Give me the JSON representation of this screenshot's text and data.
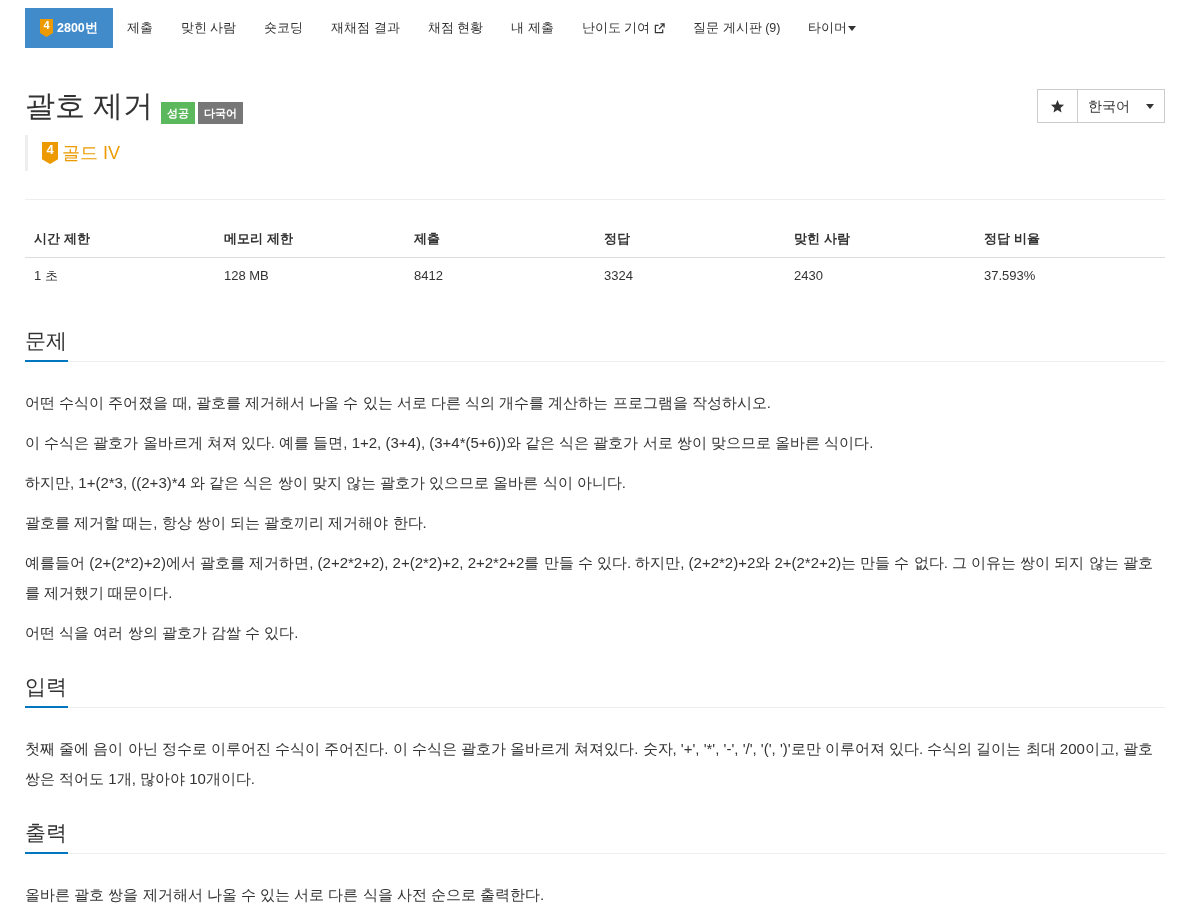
{
  "nav": {
    "tabs": [
      {
        "label": "2800번",
        "kind": "tier",
        "badge": "4",
        "selected": true
      },
      {
        "label": "제출",
        "kind": "plain",
        "selected": false
      },
      {
        "label": "맞힌 사람",
        "kind": "plain",
        "selected": false
      },
      {
        "label": "숏코딩",
        "kind": "plain",
        "selected": false
      },
      {
        "label": "재채점 결과",
        "kind": "plain",
        "selected": false
      },
      {
        "label": "채점 현황",
        "kind": "plain",
        "selected": false
      },
      {
        "label": "내 제출",
        "kind": "plain",
        "selected": false
      },
      {
        "label": "난이도 기여",
        "kind": "external",
        "selected": false
      },
      {
        "label": "질문 게시판 (9)",
        "kind": "plain",
        "selected": false
      },
      {
        "label": "타이머",
        "kind": "dropdown",
        "selected": false
      }
    ]
  },
  "problem": {
    "title": "괄호 제거",
    "labels": [
      {
        "text": "성공",
        "color": "#5cb85c"
      },
      {
        "text": "다국어",
        "color": "#777777"
      }
    ],
    "tier": {
      "badge": "4",
      "name": "골드 IV"
    }
  },
  "toolbar": {
    "language": "한국어"
  },
  "stats": {
    "columns": [
      "시간 제한",
      "메모리 제한",
      "제출",
      "정답",
      "맞힌 사람",
      "정답 비율"
    ],
    "rows": [
      [
        "1 초",
        "128 MB",
        "8412",
        "3324",
        "2430",
        "37.593%"
      ]
    ]
  },
  "sections": [
    {
      "title": "문제",
      "paragraphs": [
        "어떤 수식이 주어졌을 때, 괄호를 제거해서 나올 수 있는 서로 다른 식의 개수를 계산하는 프로그램을 작성하시오.",
        "이 수식은 괄호가 올바르게 쳐져 있다. 예를 들면, 1+2, (3+4), (3+4*(5+6))와 같은 식은 괄호가 서로 쌍이 맞으므로 올바른 식이다.",
        "하지만, 1+(2*3, ((2+3)*4 와 같은 식은 쌍이 맞지 않는 괄호가 있으므로 올바른 식이 아니다.",
        "괄호를 제거할 때는, 항상 쌍이 되는 괄호끼리 제거해야 한다.",
        "예를들어 (2+(2*2)+2)에서 괄호를 제거하면, (2+2*2+2), 2+(2*2)+2, 2+2*2+2를 만들 수 있다. 하지만, (2+2*2)+2와 2+(2*2+2)는 만들 수 없다. 그 이유는 쌍이 되지 않는 괄호를 제거했기 때문이다.",
        "어떤 식을 여러 쌍의 괄호가 감쌀 수 있다."
      ]
    },
    {
      "title": "입력",
      "paragraphs": [
        "첫째 줄에 음이 아닌 정수로 이루어진 수식이 주어진다. 이 수식은 괄호가 올바르게 쳐져있다. 숫자, '+', '*', '-', '/', '(', ')'로만 이루어져 있다. 수식의 길이는 최대 200이고, 괄호 쌍은 적어도 1개, 많아야 10개이다."
      ]
    },
    {
      "title": "출력",
      "paragraphs": [
        "올바른 괄호 쌍을 제거해서 나올 수 있는 서로 다른 식을 사전 순으로 출력한다."
      ]
    }
  ]
}
